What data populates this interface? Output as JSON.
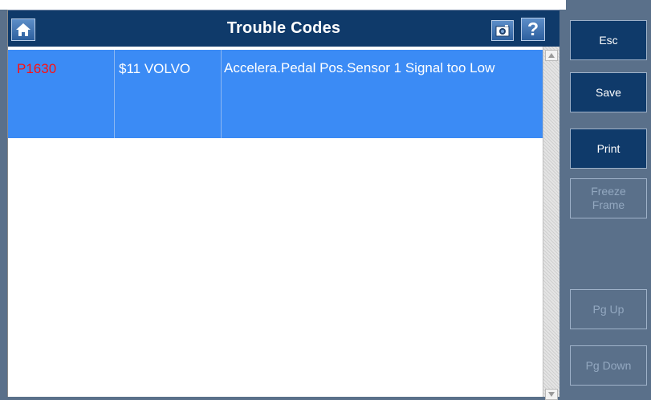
{
  "window": {
    "title": "Trouble Codes"
  },
  "toolbar": {
    "home_icon": "home-icon",
    "camera_icon": "camera-icon",
    "help_label": "?"
  },
  "codes": [
    {
      "code": "P1630",
      "module": "$11  VOLVO",
      "description": "Accelera.Pedal Pos.Sensor 1 Signal too Low",
      "selected": true
    }
  ],
  "sidebar": {
    "esc": "Esc",
    "save": "Save",
    "print": "Print",
    "freeze_frame": "Freeze Frame",
    "pg_up": "Pg Up",
    "pg_down": "Pg Down"
  },
  "colors": {
    "title_bar": "#0f3a6a",
    "selected_row": "#3b8bf5",
    "code_text": "#ff1010",
    "side_panel": "#5a708a",
    "disabled_text": "#93a8c0"
  }
}
